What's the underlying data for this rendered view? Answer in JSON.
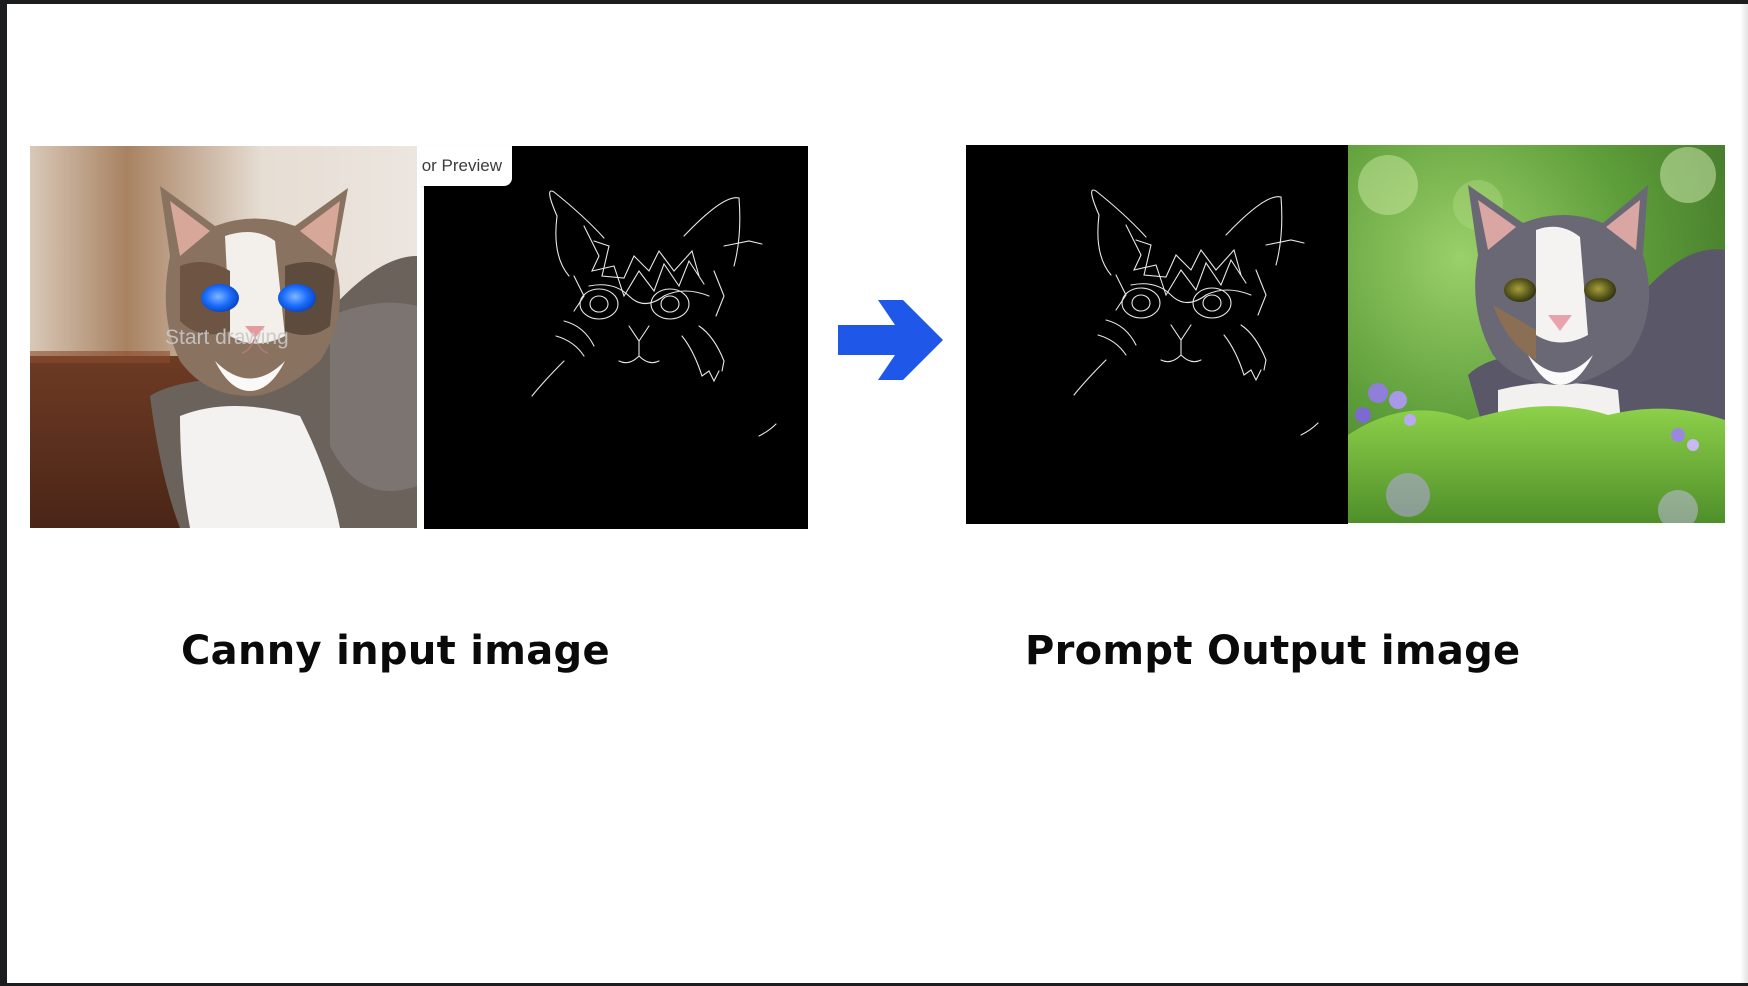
{
  "captions": {
    "left": "Canny input image",
    "right": "Prompt Output image"
  },
  "input_panel": {
    "tab_label": "or Preview",
    "overlay_hint": "Start drawing"
  },
  "icons": {
    "arrow": "arrow-right-icon"
  },
  "colors": {
    "arrow": "#1f57e8",
    "eye_highlight": "#1a6dff",
    "edge_background": "#000000"
  }
}
